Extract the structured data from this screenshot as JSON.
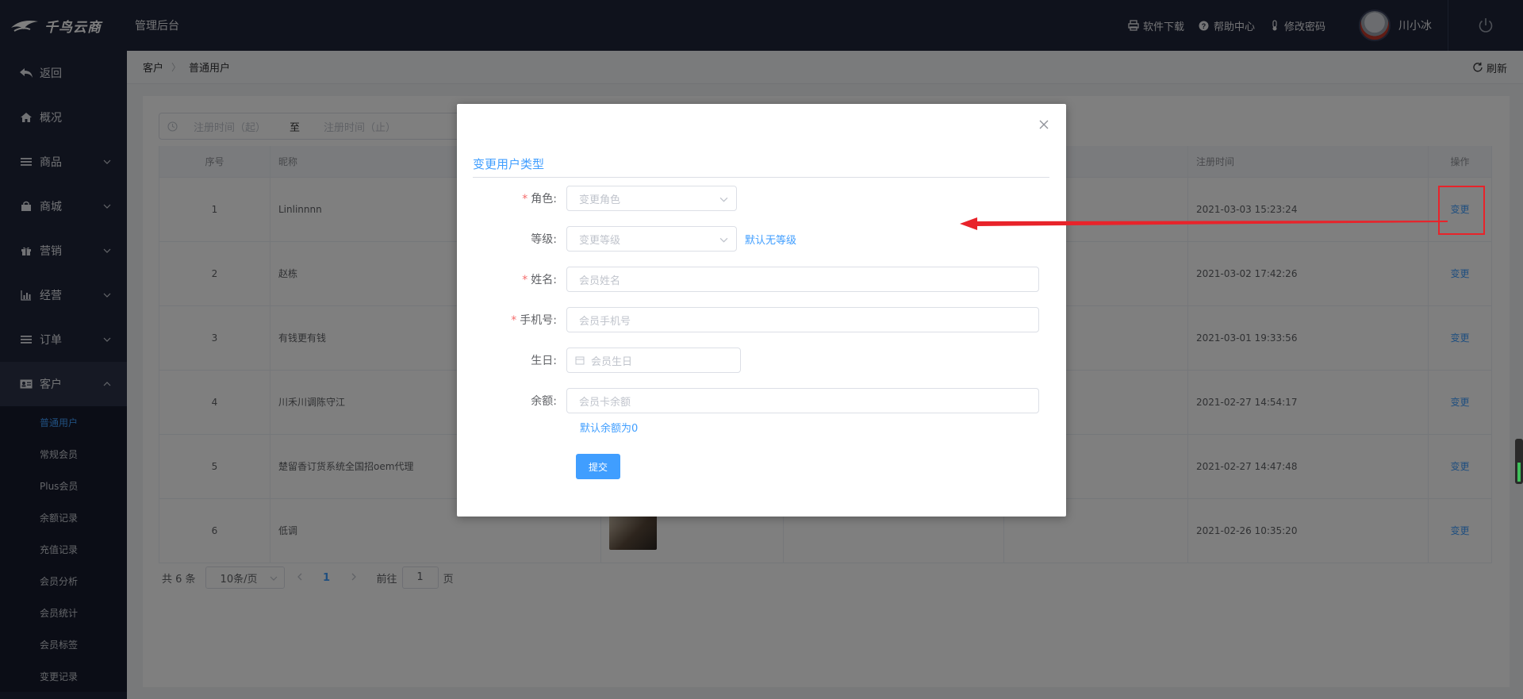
{
  "header": {
    "logo_text": "千鸟云商",
    "admin_title": "管理后台",
    "links": [
      {
        "label": "软件下载",
        "icon": "printer-icon"
      },
      {
        "label": "帮助中心",
        "icon": "help-icon"
      },
      {
        "label": "修改密码",
        "icon": "thermometer-icon"
      }
    ],
    "user_name": "川小冰"
  },
  "sidebar": {
    "back": "返回",
    "items": [
      {
        "label": "概况",
        "icon": "home-icon"
      },
      {
        "label": "商品",
        "icon": "list-icon"
      },
      {
        "label": "商城",
        "icon": "bag-icon"
      },
      {
        "label": "营销",
        "icon": "gift-icon"
      },
      {
        "label": "经营",
        "icon": "bar-chart-icon"
      },
      {
        "label": "订单",
        "icon": "list-icon"
      },
      {
        "label": "客户",
        "icon": "id-card-icon"
      }
    ],
    "sub_items": [
      "普通用户",
      "常规会员",
      "Plus会员",
      "余额记录",
      "充值记录",
      "会员分析",
      "会员统计",
      "会员标签",
      "变更记录"
    ]
  },
  "breadcrumb": {
    "parent": "客户",
    "current": "普通用户",
    "refresh": "刷新"
  },
  "filter": {
    "start_placeholder": "注册时间（起）",
    "range_sep": "至",
    "end_placeholder": "注册时间（止）"
  },
  "table": {
    "headers": [
      "序号",
      "昵称",
      "",
      "",
      "",
      "注册时间",
      "操作"
    ],
    "rows": [
      {
        "index": "1",
        "nickname": "Linlinnnn",
        "time": "2021-03-03 15:23:24",
        "action": "变更"
      },
      {
        "index": "2",
        "nickname": "赵栋",
        "time": "2021-03-02 17:42:26",
        "action": "变更"
      },
      {
        "index": "3",
        "nickname": "有钱更有钱",
        "time": "2021-03-01 19:33:56",
        "action": "变更"
      },
      {
        "index": "4",
        "nickname": "川禾川调陈守江",
        "time": "2021-02-27 14:54:17",
        "action": "变更"
      },
      {
        "index": "5",
        "nickname": "楚留香订货系统全国招oem代理",
        "time": "2021-02-27 14:47:48",
        "action": "变更"
      },
      {
        "index": "6",
        "nickname": "低调",
        "time": "2021-02-26 10:35:20",
        "action": "变更"
      }
    ]
  },
  "pagination": {
    "total": "共 6 条",
    "page_size": "10条/页",
    "current_page": "1",
    "goto_prefix": "前往",
    "goto_value": "1",
    "goto_suffix": "页"
  },
  "modal": {
    "title": "变更用户类型",
    "role_label": "角色:",
    "role_placeholder": "变更角色",
    "level_label": "等级:",
    "level_placeholder": "变更等级",
    "level_hint": "默认无等级",
    "name_label": "姓名:",
    "name_placeholder": "会员姓名",
    "phone_label": "手机号:",
    "phone_placeholder": "会员手机号",
    "birthday_label": "生日:",
    "birthday_placeholder": "会员生日",
    "balance_label": "余额:",
    "balance_placeholder": "会员卡余额",
    "balance_hint": "默认余额为0",
    "submit": "提交",
    "required_mark": "*"
  },
  "colors": {
    "accent": "#409eff",
    "header_bg": "#1f2539",
    "annotation": "#e8232a"
  }
}
